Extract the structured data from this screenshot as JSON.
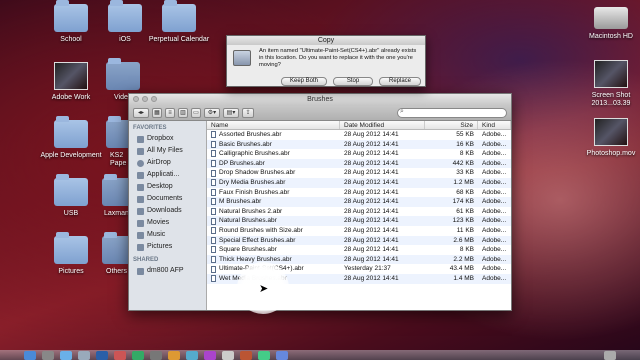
{
  "desktop_icons": [
    {
      "label": "School",
      "type": "folder"
    },
    {
      "label": "iOS",
      "type": "folder"
    },
    {
      "label": "Perpetual Calendar",
      "type": "folder"
    },
    {
      "label": "Adobe Work",
      "type": "thumb"
    },
    {
      "label": "Vide",
      "type": "folder"
    },
    {
      "label": "Apple Development",
      "type": "folder"
    },
    {
      "label": "KS2 Pape",
      "type": "folder"
    },
    {
      "label": "USB",
      "type": "folder"
    },
    {
      "label": "Laxman",
      "type": "folder"
    },
    {
      "label": "Pictures",
      "type": "folder"
    },
    {
      "label": "Others",
      "type": "folder"
    },
    {
      "label": "Macintosh HD",
      "type": "drive"
    },
    {
      "label": "Screen Shot 2013...03.39",
      "type": "thumb"
    },
    {
      "label": "Photoshop.mov",
      "type": "thumb"
    }
  ],
  "copy_dialog": {
    "title": "Copy",
    "message": "An item named \"Ultimate-Paint-Set(CS4+).abr\" already exists in this location. Do you want to replace it with the one you're moving?",
    "buttons": {
      "keep_both": "Keep Both",
      "stop": "Stop",
      "replace": "Replace"
    }
  },
  "finder": {
    "title": "Brushes",
    "sidebar": {
      "favorites_heading": "FAVORITES",
      "favorites": [
        {
          "label": "Dropbox",
          "icon": "dropbox-icon"
        },
        {
          "label": "All My Files",
          "icon": "files-icon"
        },
        {
          "label": "AirDrop",
          "icon": "airdrop-icon"
        },
        {
          "label": "Applicati...",
          "icon": "applications-icon"
        },
        {
          "label": "Desktop",
          "icon": "desktop-icon"
        },
        {
          "label": "Documents",
          "icon": "documents-icon"
        },
        {
          "label": "Downloads",
          "icon": "downloads-icon"
        },
        {
          "label": "Movies",
          "icon": "movies-icon"
        },
        {
          "label": "Music",
          "icon": "music-icon"
        },
        {
          "label": "Pictures",
          "icon": "pictures-icon"
        }
      ],
      "shared_heading": "SHARED",
      "shared": [
        {
          "label": "dm800 AFP",
          "icon": "server-icon"
        }
      ]
    },
    "columns": {
      "name": "Name",
      "date": "Date Modified",
      "size": "Size",
      "kind": "Kind"
    },
    "files": [
      {
        "name": "Assorted Brushes.abr",
        "date": "28 Aug 2012 14:41",
        "size": "55 KB",
        "kind": "Adobe..."
      },
      {
        "name": "Basic Brushes.abr",
        "date": "28 Aug 2012 14:41",
        "size": "16 KB",
        "kind": "Adobe..."
      },
      {
        "name": "Calligraphic Brushes.abr",
        "date": "28 Aug 2012 14:41",
        "size": "8 KB",
        "kind": "Adobe..."
      },
      {
        "name": "DP Brushes.abr",
        "date": "28 Aug 2012 14:41",
        "size": "442 KB",
        "kind": "Adobe..."
      },
      {
        "name": "Drop Shadow Brushes.abr",
        "date": "28 Aug 2012 14:41",
        "size": "33 KB",
        "kind": "Adobe..."
      },
      {
        "name": "Dry Media Brushes.abr",
        "date": "28 Aug 2012 14:41",
        "size": "1.2 MB",
        "kind": "Adobe..."
      },
      {
        "name": "Faux Finish Brushes.abr",
        "date": "28 Aug 2012 14:41",
        "size": "68 KB",
        "kind": "Adobe..."
      },
      {
        "name": "M Brushes.abr",
        "date": "28 Aug 2012 14:41",
        "size": "174 KB",
        "kind": "Adobe..."
      },
      {
        "name": "Natural Brushes 2.abr",
        "date": "28 Aug 2012 14:41",
        "size": "61 KB",
        "kind": "Adobe..."
      },
      {
        "name": "Natural Brushes.abr",
        "date": "28 Aug 2012 14:41",
        "size": "123 KB",
        "kind": "Adobe..."
      },
      {
        "name": "Round Brushes with Size.abr",
        "date": "28 Aug 2012 14:41",
        "size": "11 KB",
        "kind": "Adobe..."
      },
      {
        "name": "Special Effect Brushes.abr",
        "date": "28 Aug 2012 14:41",
        "size": "2.6 MB",
        "kind": "Adobe..."
      },
      {
        "name": "Square Brushes.abr",
        "date": "28 Aug 2012 14:41",
        "size": "8 KB",
        "kind": "Adobe..."
      },
      {
        "name": "Thick Heavy Brushes.abr",
        "date": "28 Aug 2012 14:41",
        "size": "2.2 MB",
        "kind": "Adobe..."
      },
      {
        "name": "Ultimate-Paint-Set(CS4+).abr",
        "date": "Yesterday 21:37",
        "size": "43.4 MB",
        "kind": "Adobe..."
      },
      {
        "name": "Wet Media Brushes.abr",
        "date": "28 Aug 2012 14:41",
        "size": "1.4 MB",
        "kind": "Adobe..."
      }
    ]
  }
}
